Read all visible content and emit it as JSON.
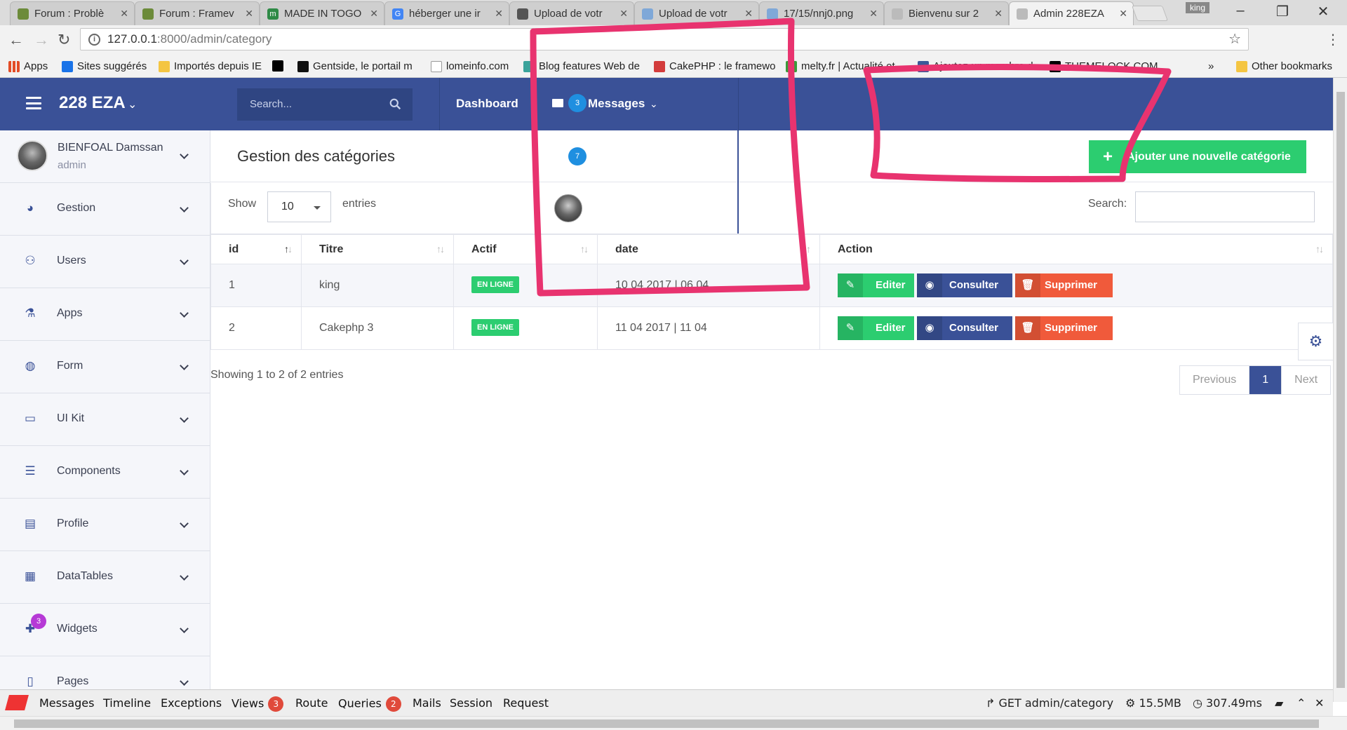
{
  "browser": {
    "tabs": [
      {
        "label": "Forum : Problè",
        "color": "#6c8b3a"
      },
      {
        "label": "Forum : Framev",
        "color": "#6c8b3a"
      },
      {
        "label": "MADE IN TOGO",
        "color": "#2e8a46"
      },
      {
        "label": "héberger une ir",
        "color": "#4285f4"
      },
      {
        "label": "Upload de votr",
        "color": "#555555"
      },
      {
        "label": "Upload de votr",
        "color": "#7fa8d8"
      },
      {
        "label": "17/15/nnj0.png",
        "color": "#7fa8d8"
      },
      {
        "label": "Bienvenu sur 2",
        "color": "#888888"
      },
      {
        "label": "Admin 228EZA",
        "color": "#888888"
      }
    ],
    "profile": "king",
    "url_host": "127.0.0.1",
    "url_path": ":8000/admin/category",
    "bookmarks": [
      {
        "label": "Apps",
        "color": "#e34c26"
      },
      {
        "label": "Sites suggérés",
        "color": "#1a73e8"
      },
      {
        "label": "Importés depuis IE",
        "color": "#f4c542"
      },
      {
        "label": "",
        "color": "#000000"
      },
      {
        "label": "Gentside, le portail m",
        "color": "#111111"
      },
      {
        "label": "lomeinfo.com",
        "color": "#cccccc"
      },
      {
        "label": "Blog features Web de",
        "color": "#3aa39b"
      },
      {
        "label": "CakePHP : le framewo",
        "color": "#d33c3c"
      },
      {
        "label": "melty.fr | Actualité et",
        "color": "#3a9b3a"
      },
      {
        "label": "Ajoutez un membre d",
        "color": "#3b5998"
      },
      {
        "label": "THEMELOCK.COM",
        "color": "#000000"
      }
    ],
    "bookmarks_more": "»",
    "other_bookmarks": "Other bookmarks"
  },
  "header": {
    "brand": "228 EZA",
    "search_placeholder": "Search...",
    "nav_dashboard": "Dashboard",
    "nav_messages": "Messages",
    "messages_count": "3"
  },
  "sidebar": {
    "user_name": "BIENFOAL Damssan",
    "user_role": "admin",
    "items": [
      {
        "label": "Gestion",
        "icon": "palette-icon"
      },
      {
        "label": "Users",
        "icon": "users-icon"
      },
      {
        "label": "Apps",
        "icon": "flask-icon"
      },
      {
        "label": "Form",
        "icon": "globe-icon"
      },
      {
        "label": "UI Kit",
        "icon": "monitor-icon"
      },
      {
        "label": "Components",
        "icon": "list-icon"
      },
      {
        "label": "Profile",
        "icon": "id-card-icon"
      },
      {
        "label": "DataTables",
        "icon": "table-icon"
      },
      {
        "label": "Widgets",
        "icon": "puzzle-icon",
        "badge": "3"
      },
      {
        "label": "Pages",
        "icon": "file-icon"
      }
    ]
  },
  "main": {
    "title": "Gestion des catégories",
    "add_button": "Ajouter une nouvelle catégorie",
    "floating_badge": "7",
    "show_label": "Show",
    "page_length": "10",
    "entries_label": "entries",
    "search_label": "Search:",
    "columns": [
      "id",
      "Titre",
      "Actif",
      "date",
      "Action"
    ],
    "rows": [
      {
        "id": "1",
        "titre": "king",
        "actif": "EN LIGNE",
        "date": "10 04 2017 | 06 04"
      },
      {
        "id": "2",
        "titre": "Cakephp 3",
        "actif": "EN LIGNE",
        "date": "11 04 2017 | 11 04"
      }
    ],
    "actions": {
      "edit": "Editer",
      "view": "Consulter",
      "delete": "Supprimer"
    },
    "info": "Showing 1 to 2 of 2 entries",
    "pager": {
      "previous": "Previous",
      "current": "1",
      "next": "Next"
    }
  },
  "debugbar": {
    "tabs": [
      {
        "label": "Messages"
      },
      {
        "label": "Timeline"
      },
      {
        "label": "Exceptions"
      },
      {
        "label": "Views",
        "badge": "3"
      },
      {
        "label": "Route"
      },
      {
        "label": "Queries",
        "badge": "2"
      },
      {
        "label": "Mails"
      },
      {
        "label": "Session"
      },
      {
        "label": "Request"
      }
    ],
    "request": "GET admin/category",
    "memory": "15.5MB",
    "time": "307.49ms"
  },
  "colors": {
    "header": "#3a5197",
    "success": "#2ccd70",
    "danger": "#f05a3b",
    "annotation": "#e8336f"
  }
}
